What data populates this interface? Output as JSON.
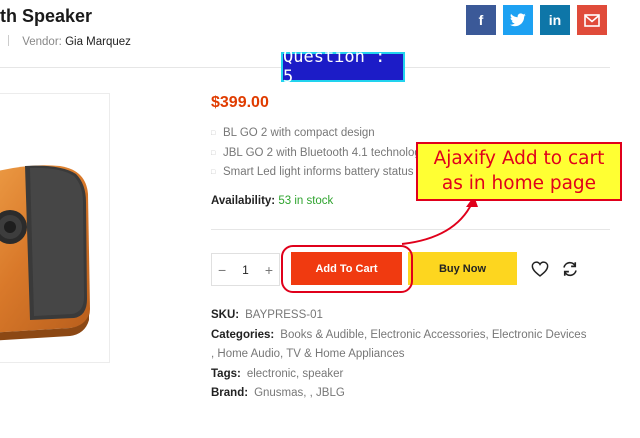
{
  "product": {
    "title": "th Speaker",
    "vendor_label": "Vendor:",
    "vendor_name": "Gia Marquez",
    "price": "$399.00",
    "features": [
      "BL GO 2 with compact design",
      "JBL GO 2 with Bluetooth 4.1 technology",
      "Smart Led light informs battery status"
    ],
    "availability_label": "Availability:",
    "availability_value": "53 in stock",
    "quantity": "1",
    "add_to_cart_label": "Add To Cart",
    "buy_now_label": "Buy Now"
  },
  "details": {
    "sku_label": "SKU:",
    "sku_value": "BAYPRESS-01",
    "categories_label": "Categories:",
    "categories_line1": "Books & Audible, Electronic Accessories, Electronic Devices",
    "categories_line2": ", Home Audio, TV & Home Appliances",
    "tags_label": "Tags:",
    "tags_value": "electronic, speaker",
    "brand_label": "Brand:",
    "brand_value": "Gnusmas, , JBLG"
  },
  "share": {
    "icons": [
      "facebook-icon",
      "twitter-icon",
      "linkedin-icon",
      "mail-icon"
    ],
    "facebook_glyph": "f",
    "linkedin_glyph": "in"
  },
  "annotation": {
    "question_label": "Question : 5",
    "callout_line1": "Ajaxify Add to cart",
    "callout_line2": "as in home page"
  },
  "colors": {
    "price": "#e03c00",
    "add_to_cart_bg": "#f03a10",
    "buy_now_bg": "#fdd61f",
    "in_stock": "#2fa42f",
    "annotation_red": "#e0001b",
    "callout_bg": "#ffff33",
    "question_bg": "#1c1cc7"
  }
}
